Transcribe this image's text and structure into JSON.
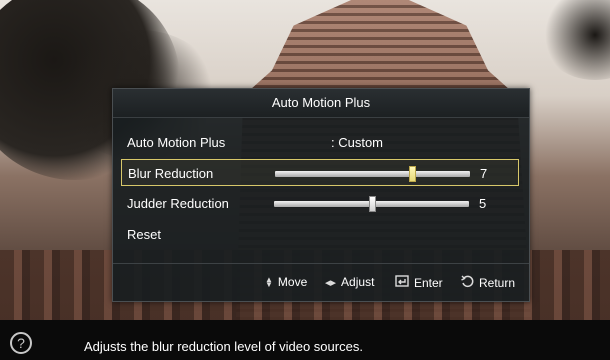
{
  "dialog": {
    "title": "Auto Motion Plus",
    "rows": [
      {
        "label": "Auto Motion Plus",
        "value": ": Custom"
      },
      {
        "label": "Blur Reduction",
        "slider_value": 7,
        "slider_fraction": 0.7
      },
      {
        "label": "Judder Reduction",
        "slider_value": 5,
        "slider_fraction": 0.5
      },
      {
        "label": "Reset"
      }
    ]
  },
  "footer": {
    "move": "Move",
    "adjust": "Adjust",
    "enter": "Enter",
    "return": "Return"
  },
  "bottombar": {
    "description": "Adjusts the blur reduction level of video sources.",
    "help_icon": "?"
  },
  "colors": {
    "selection_border": "#d8c86a",
    "dialog_bg": "#191e20"
  }
}
